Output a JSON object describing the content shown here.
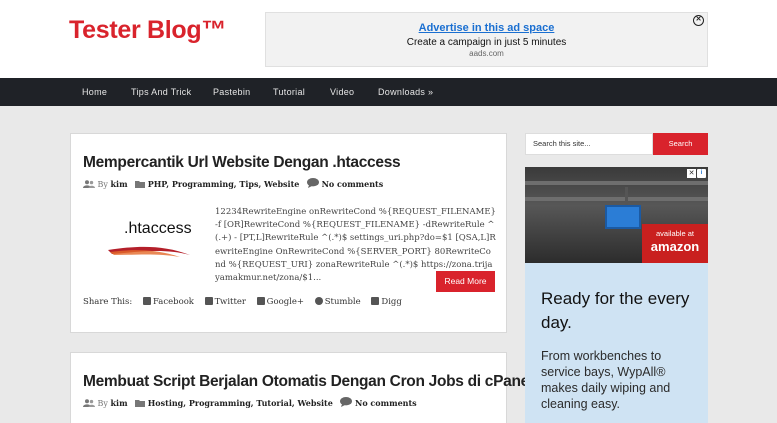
{
  "site": {
    "title": "Tester Blog™"
  },
  "top_ad": {
    "title": "Advertise in this ad space",
    "subtitle": "Create a campaign in just 5 minutes",
    "source": "aads.com"
  },
  "nav": {
    "items": [
      {
        "label": "Home"
      },
      {
        "label": "Tips And Trick"
      },
      {
        "label": "Pastebin"
      },
      {
        "label": "Tutorial"
      },
      {
        "label": "Video"
      },
      {
        "label": "Downloads »"
      }
    ]
  },
  "posts": [
    {
      "title": "Mempercantik Url Website Dengan .htaccess",
      "by_label": "By",
      "author": "kim",
      "categories": "PHP, Programming, Tips, Website",
      "comments": "No comments",
      "thumb_text": ".htaccess",
      "excerpt": "12234RewriteEngine onRewriteCond %{REQUEST_FILENAME} -f [OR]RewriteCond %{REQUEST_FILENAME} -dRewriteRule ^(.+) - [PT,L]RewriteRule ^(.*)$ settings_uri.php?do=$1 [QSA,L]RewriteEngine OnRewriteCond %{SERVER_PORT} 80RewriteCond %{REQUEST_URI} zonaRewriteRule ^(.*)$ https://zona.trijayamakmur.net/zona/$1...",
      "read_more": "Read More",
      "share_label": "Share This:",
      "share": [
        "Facebook",
        "Twitter",
        "Google+",
        "Stumble",
        "Digg"
      ]
    },
    {
      "title": "Membuat Script Berjalan Otomatis Dengan Cron Jobs di cPanel",
      "by_label": "By",
      "author": "kim",
      "categories": "Hosting, Programming, Tutorial, Website",
      "comments": "No comments"
    }
  ],
  "sidebar": {
    "search_placeholder": "Search this site...",
    "search_button": "Search",
    "ad": {
      "info": "i",
      "close": "✕",
      "badge_top": "available at",
      "badge_brand": "amazon",
      "headline": "Ready for the every day.",
      "body": "From workbenches to service bays, WypAll® makes daily wiping and cleaning easy."
    }
  },
  "colors": {
    "accent": "#d9232c",
    "nav_bg": "#1f2227",
    "link": "#1a6fd1"
  }
}
